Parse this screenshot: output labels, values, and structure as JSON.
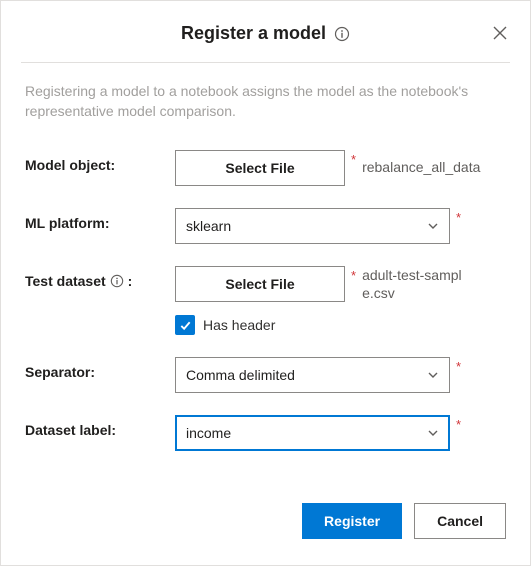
{
  "dialog": {
    "title": "Register a model",
    "description": "Registering a model to a notebook assigns the model as the notebook's representative model comparison."
  },
  "form": {
    "model_object": {
      "label": "Model object:",
      "button": "Select File",
      "value": "rebalance_all_data",
      "required": true
    },
    "ml_platform": {
      "label": "ML platform:",
      "value": "sklearn",
      "required": true
    },
    "test_dataset": {
      "label": "Test dataset",
      "label_suffix": ":",
      "button": "Select File",
      "value": "adult-test-sample.csv",
      "required": true,
      "has_header": {
        "label": "Has header",
        "checked": true
      }
    },
    "separator": {
      "label": "Separator:",
      "value": "Comma delimited",
      "required": true
    },
    "dataset_label": {
      "label": "Dataset label:",
      "value": "income",
      "required": true
    }
  },
  "footer": {
    "register": "Register",
    "cancel": "Cancel"
  },
  "glyphs": {
    "asterisk": "*"
  }
}
